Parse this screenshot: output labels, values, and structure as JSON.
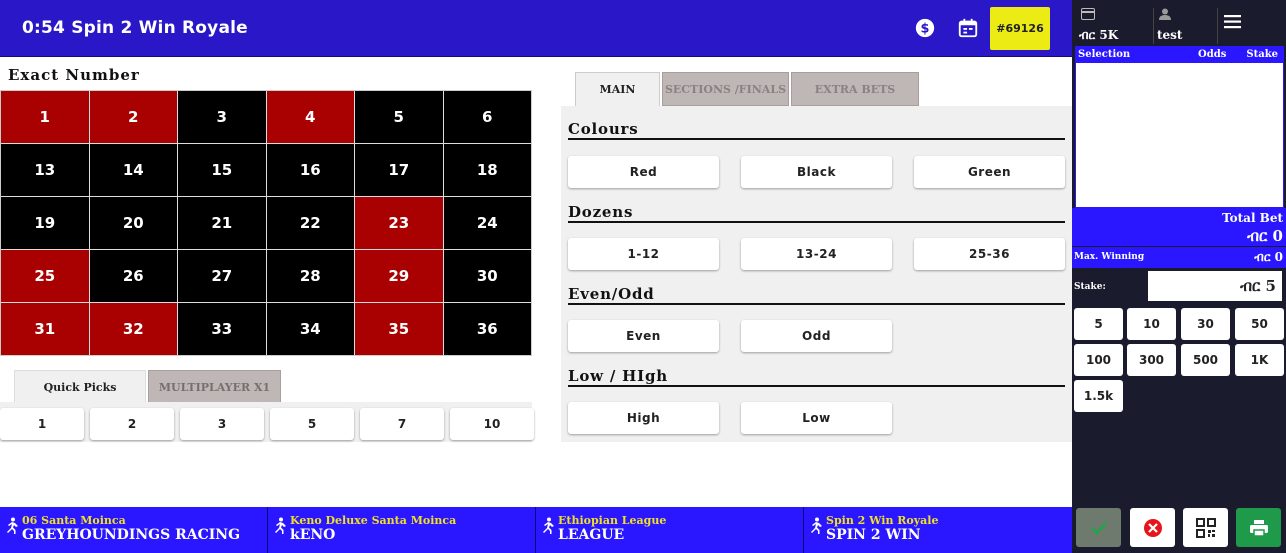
{
  "header": {
    "title": "0:54 Spin 2 Win Royale",
    "ticket_badge": "#69126",
    "icons": [
      "dollar-coin-icon",
      "calendar-icon"
    ]
  },
  "board": {
    "title": "Exact Number",
    "cells": [
      {
        "n": "1",
        "color": "red"
      },
      {
        "n": "2",
        "color": "red"
      },
      {
        "n": "3",
        "color": "black"
      },
      {
        "n": "4",
        "color": "red"
      },
      {
        "n": "5",
        "color": "black"
      },
      {
        "n": "6",
        "color": "black"
      },
      {
        "n": "13",
        "color": "black"
      },
      {
        "n": "14",
        "color": "black"
      },
      {
        "n": "15",
        "color": "black"
      },
      {
        "n": "16",
        "color": "black"
      },
      {
        "n": "17",
        "color": "black"
      },
      {
        "n": "18",
        "color": "black"
      },
      {
        "n": "19",
        "color": "black"
      },
      {
        "n": "20",
        "color": "black"
      },
      {
        "n": "21",
        "color": "black"
      },
      {
        "n": "22",
        "color": "black"
      },
      {
        "n": "23",
        "color": "red"
      },
      {
        "n": "24",
        "color": "black"
      },
      {
        "n": "25",
        "color": "red"
      },
      {
        "n": "26",
        "color": "black"
      },
      {
        "n": "27",
        "color": "black"
      },
      {
        "n": "28",
        "color": "black"
      },
      {
        "n": "29",
        "color": "red"
      },
      {
        "n": "30",
        "color": "black"
      },
      {
        "n": "31",
        "color": "red"
      },
      {
        "n": "32",
        "color": "red"
      },
      {
        "n": "33",
        "color": "black"
      },
      {
        "n": "34",
        "color": "black"
      },
      {
        "n": "35",
        "color": "red"
      },
      {
        "n": "36",
        "color": "black"
      }
    ],
    "red_color": "#a90101",
    "black_color": "#000000"
  },
  "quick_picks": {
    "tabs": [
      "Quick Picks",
      "MULTIPLAYER X1"
    ],
    "buttons": [
      "1",
      "2",
      "3",
      "5",
      "7",
      "10"
    ]
  },
  "bet_tabs": [
    "MAIN",
    "SECTIONS /FINALS",
    "EXTRA BETS"
  ],
  "groups": {
    "colours": {
      "title": "Colours",
      "buttons": [
        "Red",
        "Black",
        "Green"
      ]
    },
    "dozens": {
      "title": "Dozens",
      "buttons": [
        "1-12",
        "13-24",
        "25-36"
      ]
    },
    "even_odd": {
      "title": "Even/Odd",
      "buttons": [
        "Even",
        "Odd"
      ]
    },
    "low_high": {
      "title": "Low / HIgh",
      "buttons": [
        "High",
        "Low"
      ]
    }
  },
  "footer": {
    "games": [
      {
        "sub": "06 Santa Moinca",
        "main": "GREYHOUNDINGS RACING"
      },
      {
        "sub": "Keno Deluxe Santa Moinca",
        "main": "kENO"
      },
      {
        "sub": "Ethiopian League",
        "main": "LEAGUE"
      },
      {
        "sub": "Spin 2 Win Royale",
        "main": "SPIN 2 WIN"
      }
    ]
  },
  "sidebar": {
    "balance": "ብር 5K",
    "username": "test",
    "slip_headers": {
      "selection": "Selection",
      "odds": "Odds",
      "stake": "Stake"
    },
    "total_bet_label": "Total Bet",
    "total_bet_value": "ብር 0",
    "max_winning_label": "Max. Winning",
    "max_winning_value": "ብር 0",
    "stake_label": "Stake:",
    "stake_value": "ብር 5",
    "chips": [
      "5",
      "10",
      "30",
      "50",
      "100",
      "300",
      "500",
      "1K",
      "1.5k"
    ],
    "actions": [
      "confirm-check-icon",
      "cancel-x-icon",
      "qr-code-icon",
      "print-icon"
    ]
  },
  "colors": {
    "header_blue": "#2a17c7",
    "footer_blue": "#2a17ff",
    "badge_yellow": "#ecec14",
    "sidebar_dark": "#1b1b2e",
    "game_sub_yellow": "#f0e02a"
  }
}
